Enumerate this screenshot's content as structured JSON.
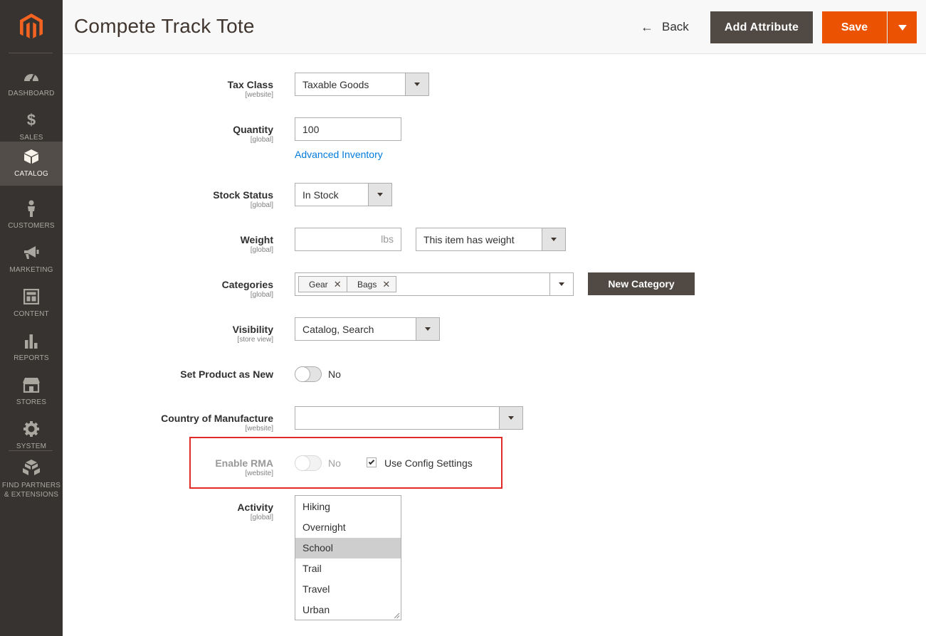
{
  "sidebar": {
    "logo": "magento-logo",
    "items": [
      {
        "label": "DASHBOARD",
        "icon": "dashboard-icon"
      },
      {
        "label": "SALES",
        "icon": "dollar-icon"
      },
      {
        "label": "CATALOG",
        "icon": "box-icon",
        "active": true
      },
      {
        "label": "CUSTOMERS",
        "icon": "person-icon"
      },
      {
        "label": "MARKETING",
        "icon": "megaphone-icon"
      },
      {
        "label": "CONTENT",
        "icon": "layout-icon"
      },
      {
        "label": "REPORTS",
        "icon": "bar-chart-icon"
      },
      {
        "label": "STORES",
        "icon": "store-icon"
      },
      {
        "label": "SYSTEM",
        "icon": "gear-icon"
      }
    ],
    "partners": {
      "line1": "FIND PARTNERS",
      "line2": "& EXTENSIONS",
      "icon": "blocks-icon"
    }
  },
  "header": {
    "title": "Compete Track Tote",
    "back_label": "Back",
    "add_attribute_label": "Add Attribute",
    "save_label": "Save"
  },
  "form": {
    "tax_class": {
      "label": "Tax Class",
      "scope": "[website]",
      "value": "Taxable Goods"
    },
    "quantity": {
      "label": "Quantity",
      "scope": "[global]",
      "value": "100",
      "link": "Advanced Inventory"
    },
    "stock_status": {
      "label": "Stock Status",
      "scope": "[global]",
      "value": "In Stock"
    },
    "weight": {
      "label": "Weight",
      "scope": "[global]",
      "value": "",
      "suffix": "lbs",
      "type_value": "This item has weight"
    },
    "categories": {
      "label": "Categories",
      "scope": "[global]",
      "tags": [
        "Gear",
        "Bags"
      ],
      "new_button": "New Category"
    },
    "visibility": {
      "label": "Visibility",
      "scope": "[store view]",
      "value": "Catalog, Search"
    },
    "set_new": {
      "label": "Set Product as New",
      "state": "No"
    },
    "country": {
      "label": "Country of Manufacture",
      "scope": "[website]",
      "value": ""
    },
    "enable_rma": {
      "label": "Enable RMA",
      "scope": "[website]",
      "state": "No",
      "use_config_label": "Use Config Settings",
      "use_config_checked": true
    },
    "activity": {
      "label": "Activity",
      "scope": "[global]",
      "options": [
        "Hiking",
        "Overnight",
        "School",
        "Trail",
        "Travel",
        "Urban"
      ],
      "selected": "School"
    }
  },
  "colors": {
    "sidebar_bg": "#373330",
    "active_bg": "#524d49",
    "save_orange": "#eb5202",
    "dark_button": "#514943",
    "link_blue": "#007bdb",
    "highlight_red": "#e02b27"
  }
}
